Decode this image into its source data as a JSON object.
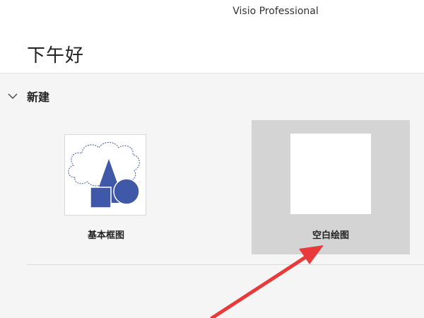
{
  "window": {
    "app_title": "Visio Professional"
  },
  "home": {
    "greeting": "下午好"
  },
  "new_section": {
    "label": "新建",
    "expanded": true,
    "templates": [
      {
        "label": "基本框图",
        "thumbnail": "basic-diagram-thumbnail",
        "selected": false
      },
      {
        "label": "空白绘图",
        "thumbnail": "blank-drawing-thumbnail",
        "selected": true
      }
    ]
  },
  "colors": {
    "shape_fill": "#3f58a8",
    "selected_bg": "#d4d4d4",
    "arrow": "#e8393b"
  },
  "icons": {
    "section_toggle": "chevron-down-icon",
    "annotation": "red-arrow-annotation"
  }
}
